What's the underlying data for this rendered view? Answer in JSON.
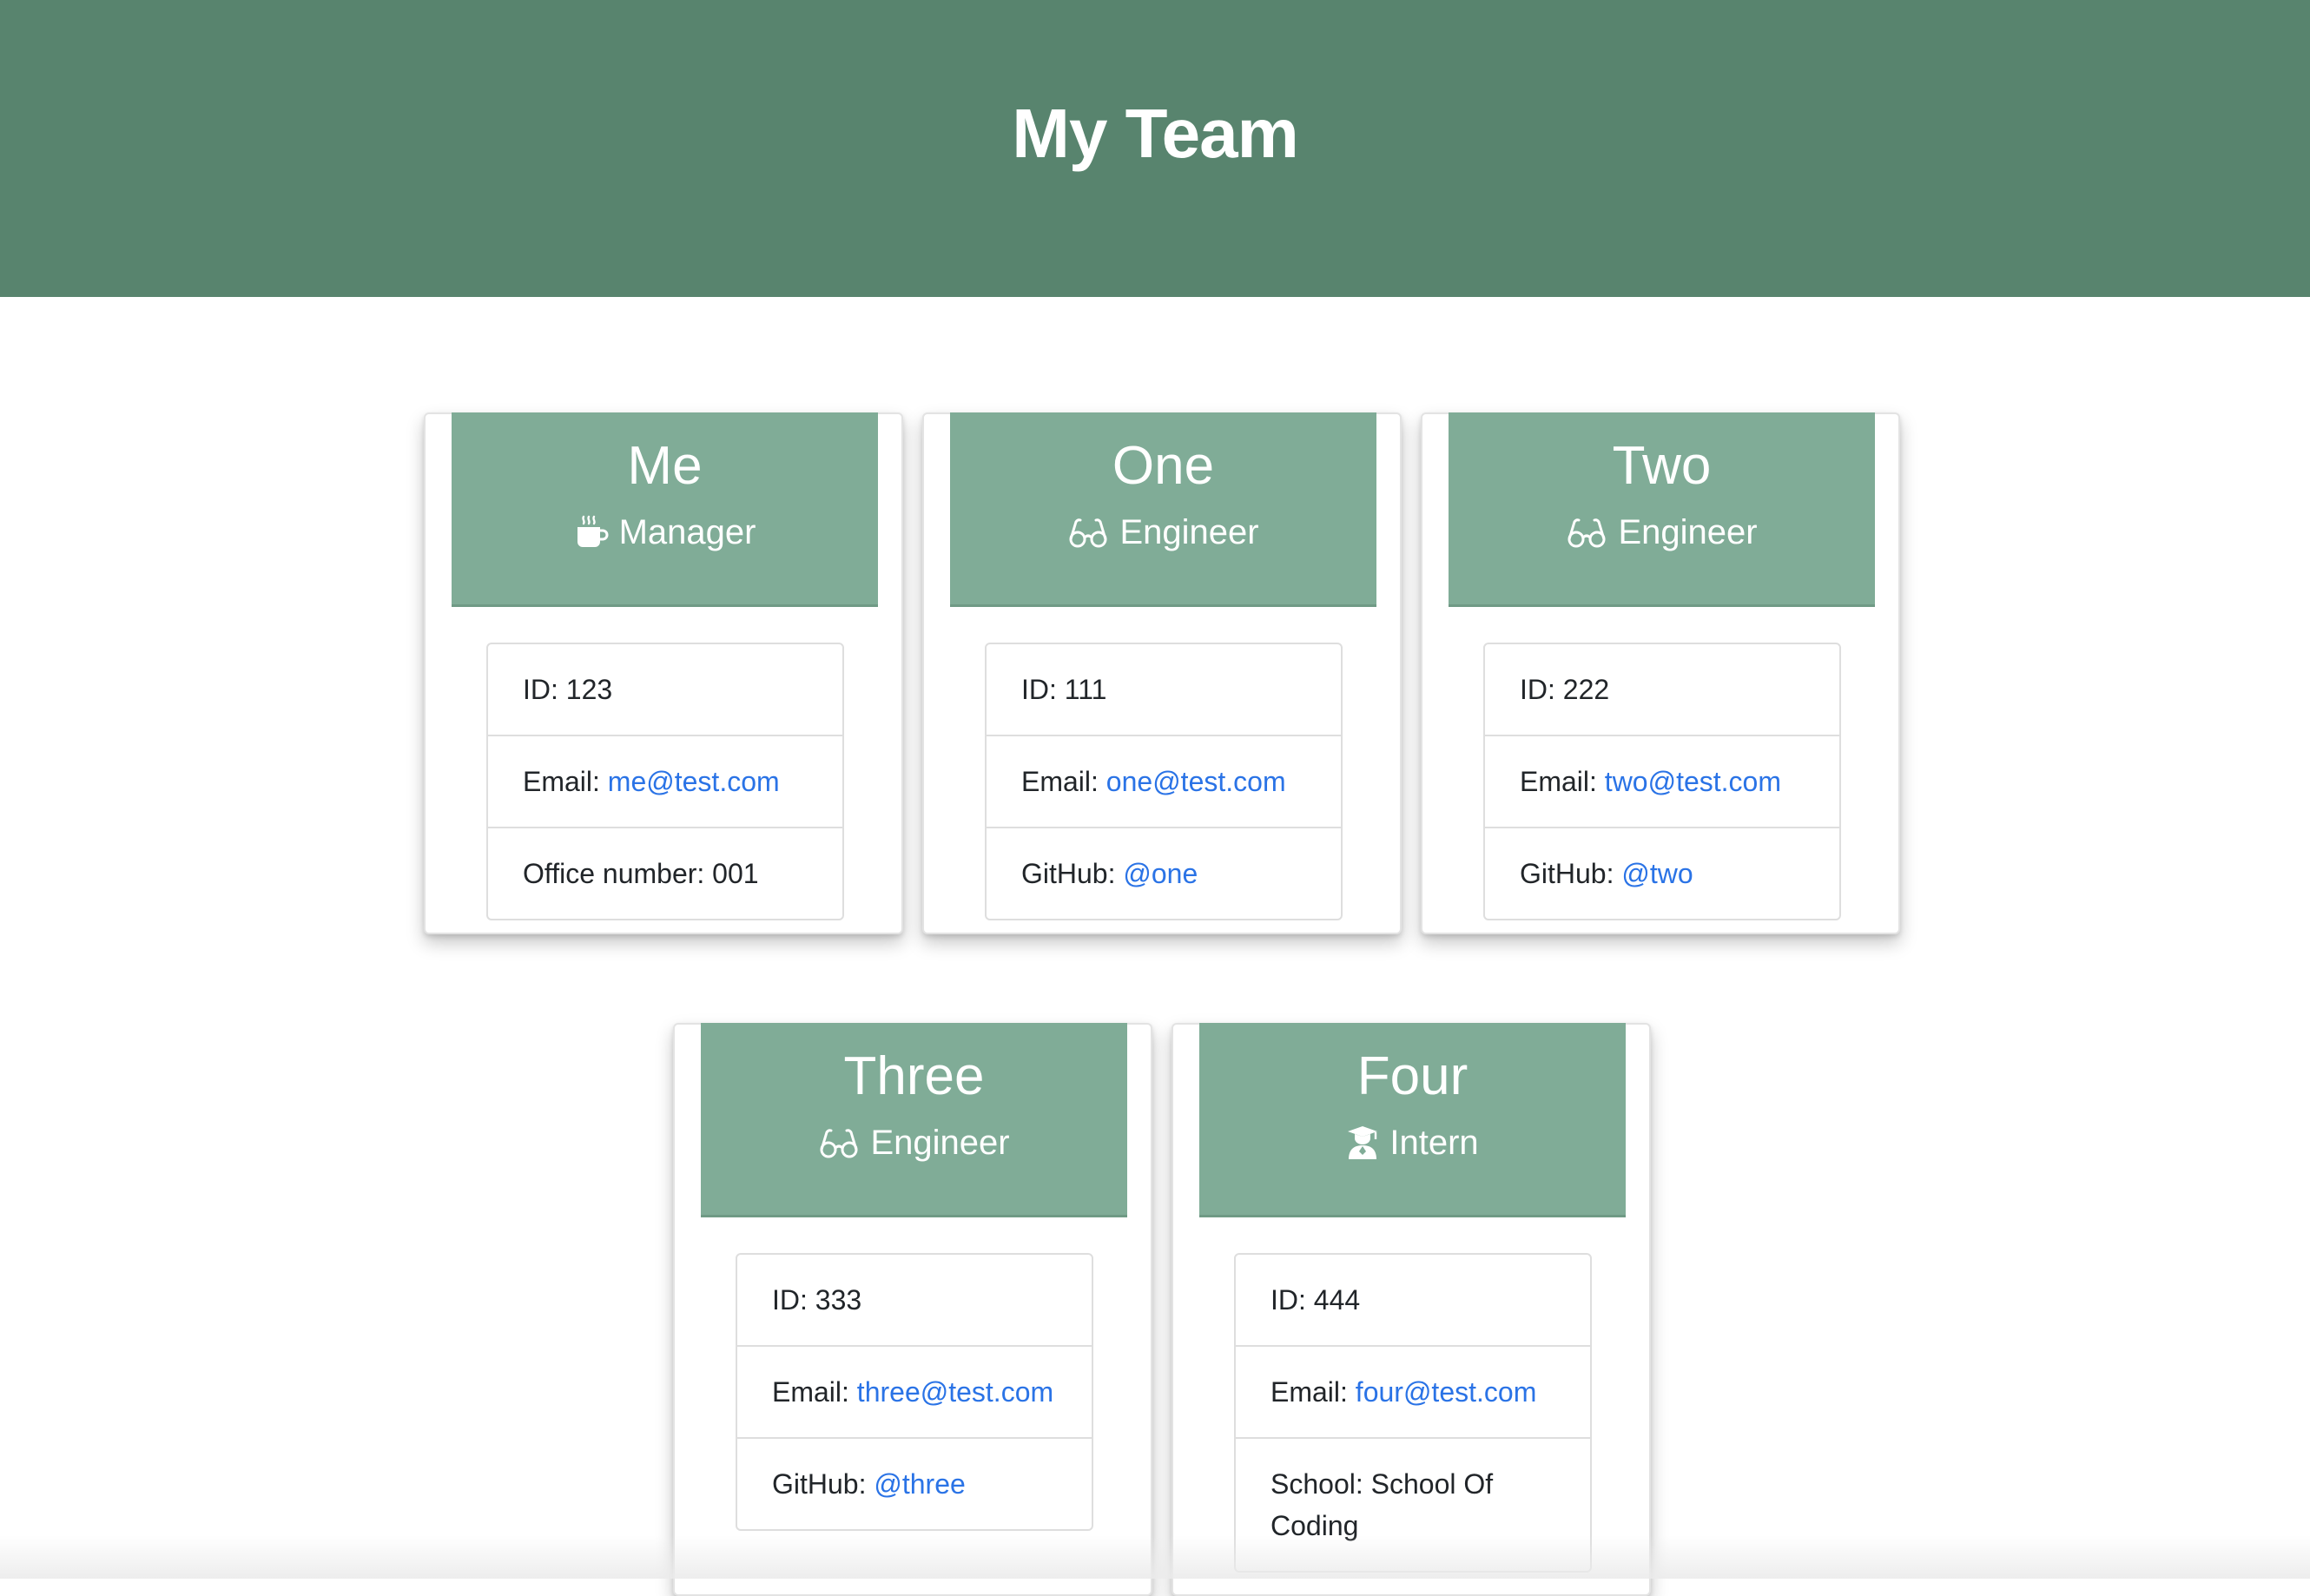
{
  "header": {
    "title": "My Team"
  },
  "team": [
    {
      "name": "Me",
      "role": "Manager",
      "icon": "coffee-mug-icon",
      "id_text": "ID: 123",
      "email_label": "Email: ",
      "email": "me@test.com",
      "extra_label": "Office number: 001",
      "extra_value": ""
    },
    {
      "name": "One",
      "role": "Engineer",
      "icon": "glasses-icon",
      "id_text": "ID: 111",
      "email_label": "Email: ",
      "email": "one@test.com",
      "extra_label": "GitHub: ",
      "extra_value": "@one"
    },
    {
      "name": "Two",
      "role": "Engineer",
      "icon": "glasses-icon",
      "id_text": "ID: 222",
      "email_label": "Email: ",
      "email": "two@test.com",
      "extra_label": "GitHub: ",
      "extra_value": "@two"
    },
    {
      "name": "Three",
      "role": "Engineer",
      "icon": "glasses-icon",
      "id_text": "ID: 333",
      "email_label": "Email: ",
      "email": "three@test.com",
      "extra_label": "GitHub: ",
      "extra_value": "@three"
    },
    {
      "name": "Four",
      "role": "Intern",
      "icon": "graduate-icon",
      "id_text": "ID: 444",
      "email_label": "Email: ",
      "email": "four@test.com",
      "extra_label": "School: School Of Coding",
      "extra_value": ""
    }
  ],
  "colors": {
    "header_bg": "#58846e",
    "card_head_bg": "#80ac97",
    "link": "#2a73e6"
  }
}
